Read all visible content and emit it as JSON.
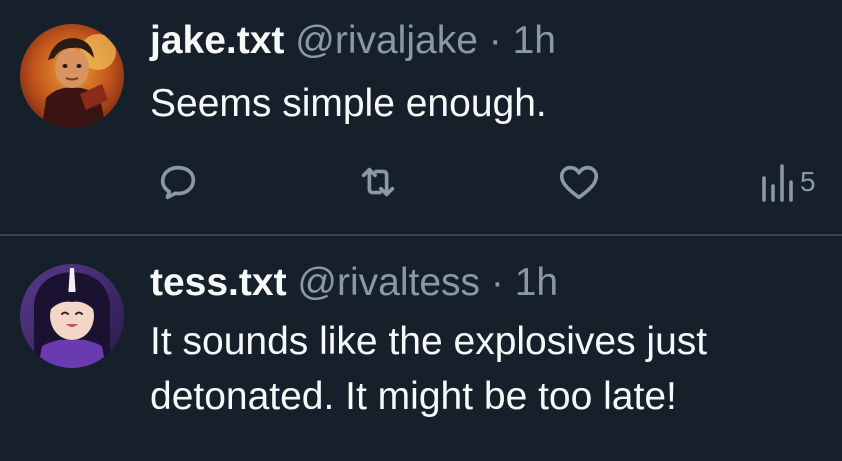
{
  "tweets": [
    {
      "display_name": "jake.txt",
      "handle": "@rivaljake",
      "separator": "·",
      "time": "1h",
      "text_lines": [
        "Seems simple enough."
      ],
      "avatar_icon": "avatar-jake-icon",
      "actions": {
        "reply_icon": "reply-icon",
        "retweet_icon": "retweet-icon",
        "like_icon": "heart-icon",
        "views_icon": "views-icon",
        "views_count": "5"
      }
    },
    {
      "display_name": "tess.txt",
      "handle": "@rivaltess",
      "separator": "·",
      "time": "1h",
      "text_lines": [
        "It sounds like the explosives just",
        "detonated. It might be too late!"
      ],
      "avatar_icon": "avatar-tess-icon"
    }
  ],
  "colors": {
    "background": "#15202b",
    "text_primary": "#f7f9f9",
    "text_secondary": "#8b98a5",
    "divider": "#38444d"
  }
}
